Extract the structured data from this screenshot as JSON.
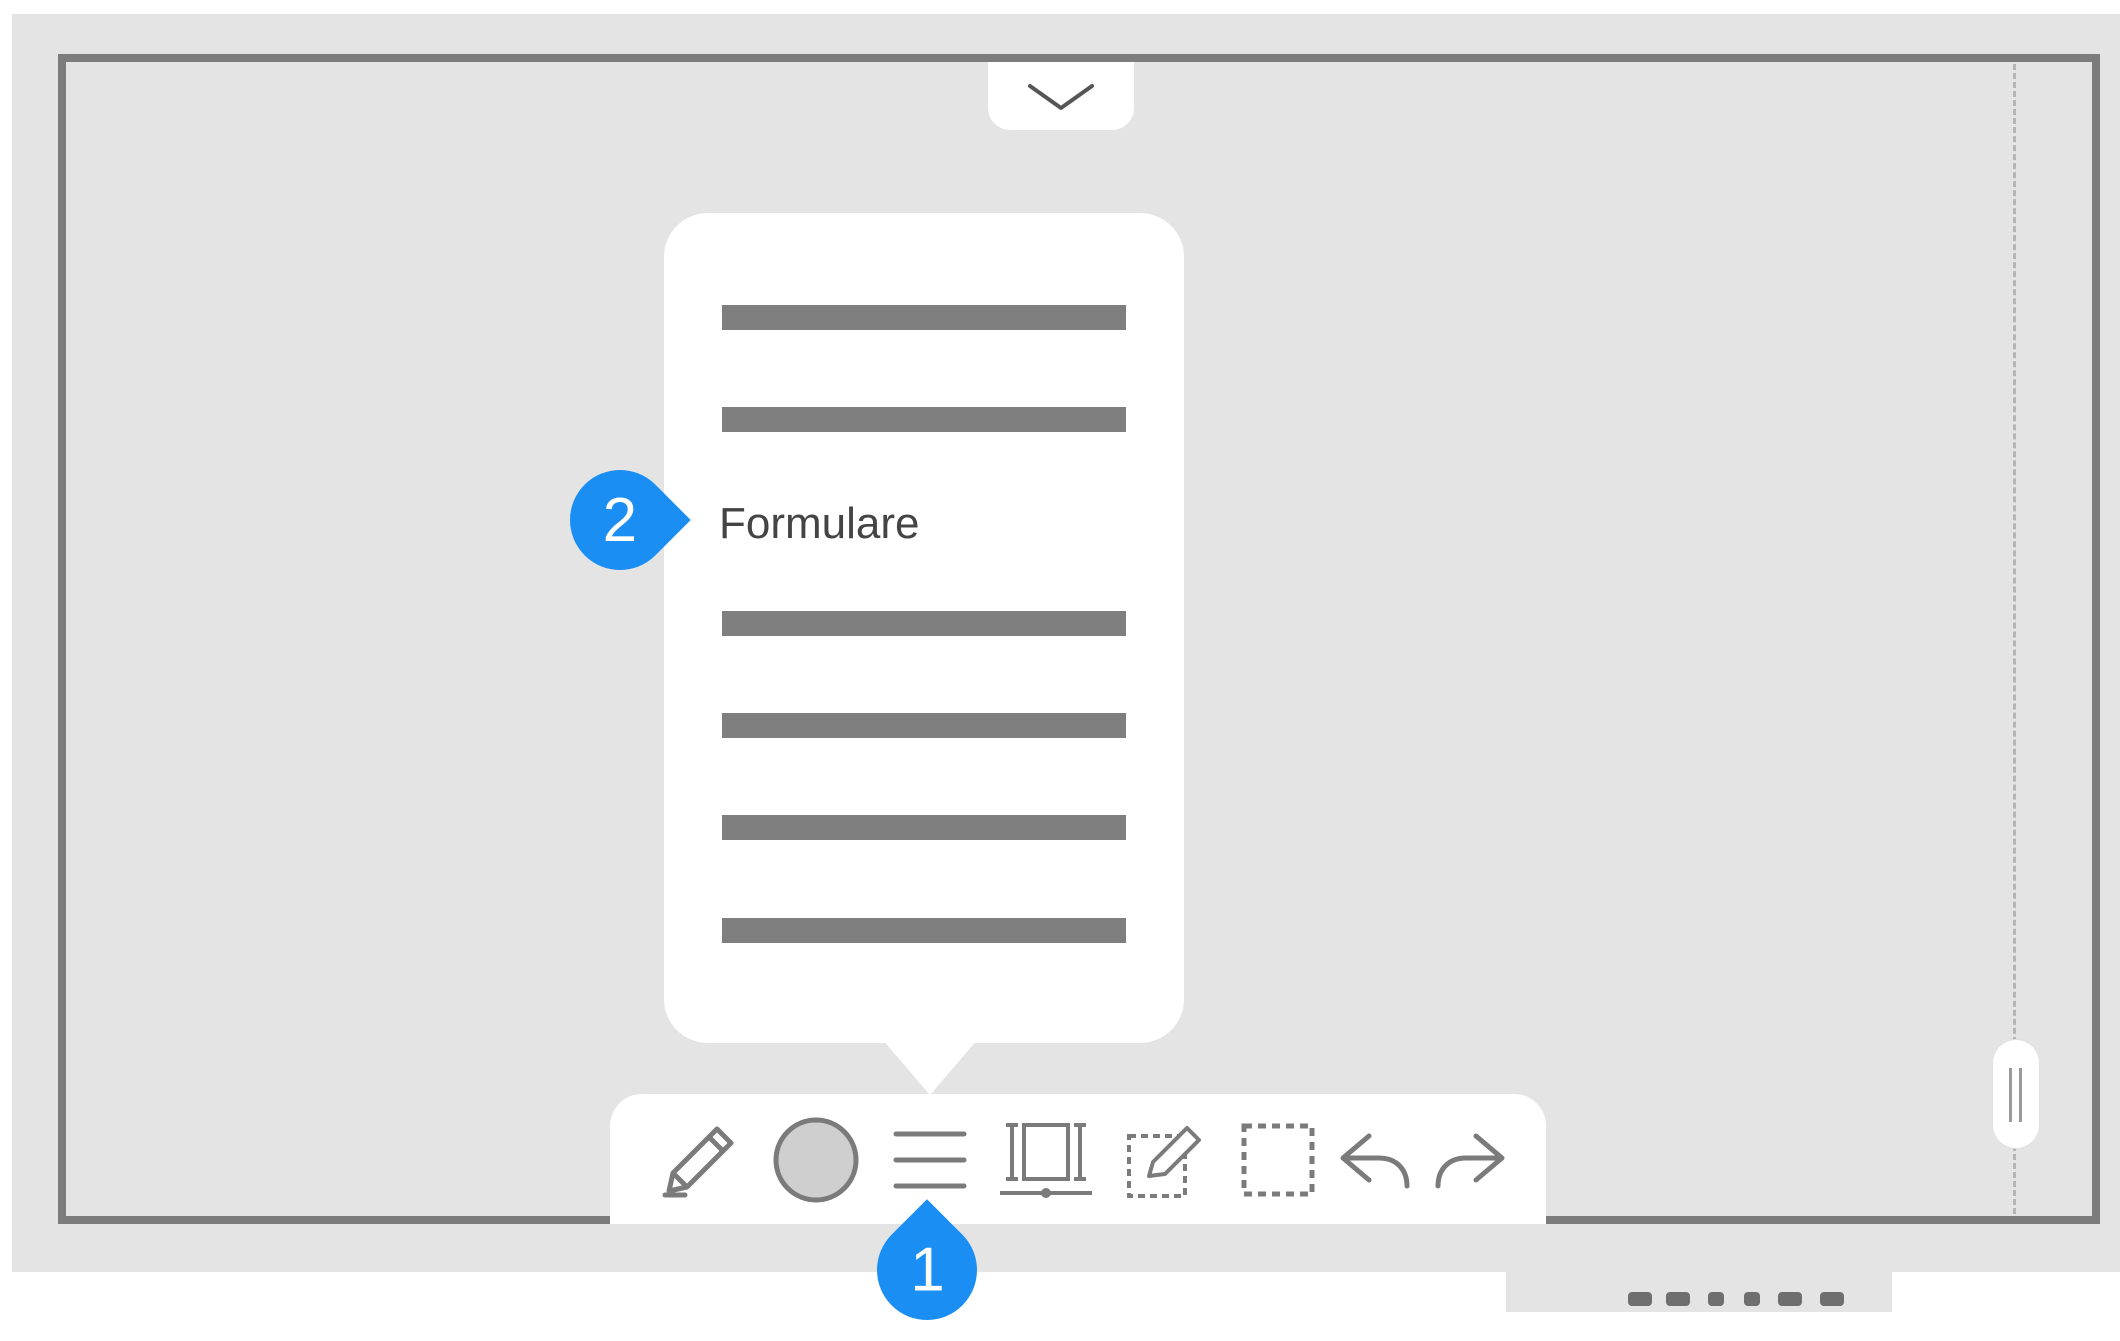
{
  "popup_menu": {
    "items": [
      {
        "label": "",
        "redacted": true
      },
      {
        "label": "",
        "redacted": true
      },
      {
        "label": "Formulare",
        "redacted": false
      },
      {
        "label": "",
        "redacted": true
      },
      {
        "label": "",
        "redacted": true
      },
      {
        "label": "",
        "redacted": true
      },
      {
        "label": "",
        "redacted": true
      }
    ]
  },
  "callouts": {
    "one": "1",
    "two": "2"
  },
  "toolbar": {
    "tools": [
      {
        "name": "pen",
        "icon": "pencil-icon"
      },
      {
        "name": "color",
        "icon": "color-circle-icon",
        "color": "#cfcfcf"
      },
      {
        "name": "menu",
        "icon": "hamburger-menu-icon"
      },
      {
        "name": "page-size",
        "icon": "page-width-icon"
      },
      {
        "name": "edit-page",
        "icon": "edit-page-icon"
      },
      {
        "name": "select",
        "icon": "selection-icon"
      },
      {
        "name": "undo",
        "icon": "undo-icon"
      },
      {
        "name": "redo",
        "icon": "redo-icon"
      }
    ]
  },
  "colors": {
    "background": "#e4e4e4",
    "frame": "#7c7c7c",
    "callout": "#1a8ef2",
    "redaction_bar": "#7f7f7f"
  }
}
